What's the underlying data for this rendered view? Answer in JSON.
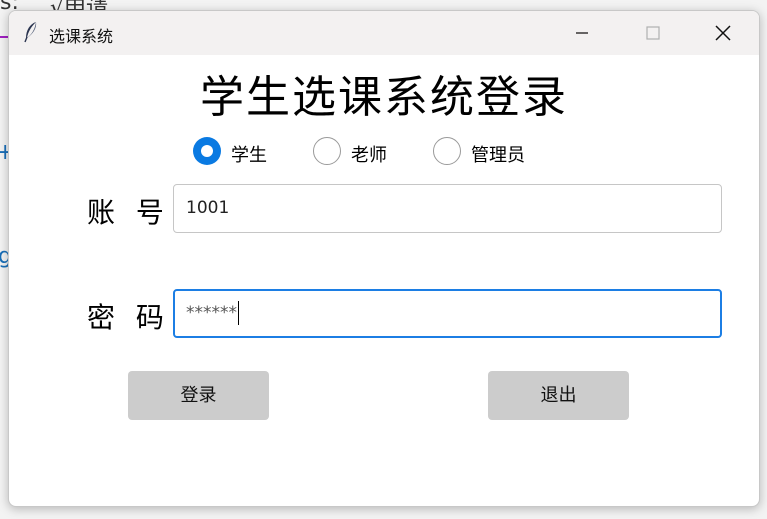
{
  "background": {
    "fragment_left": "s:",
    "fragment_top": "√申请",
    "fragment_mid": "+",
    "fragment_g": "g"
  },
  "window": {
    "title": "选课系统",
    "icon": "feather-icon"
  },
  "heading": "学生选课系统登录",
  "roles": [
    {
      "label": "学生",
      "checked": true
    },
    {
      "label": "老师",
      "checked": false
    },
    {
      "label": "管理员",
      "checked": false
    }
  ],
  "form": {
    "account_label": "账 号",
    "account_value": "1001",
    "password_label": "密 码",
    "password_value": "******"
  },
  "buttons": {
    "login": "登录",
    "exit": "退出"
  },
  "colors": {
    "accent": "#0a7ae2",
    "button_bg": "#cccccc",
    "titlebar": "#f3f1f1"
  }
}
